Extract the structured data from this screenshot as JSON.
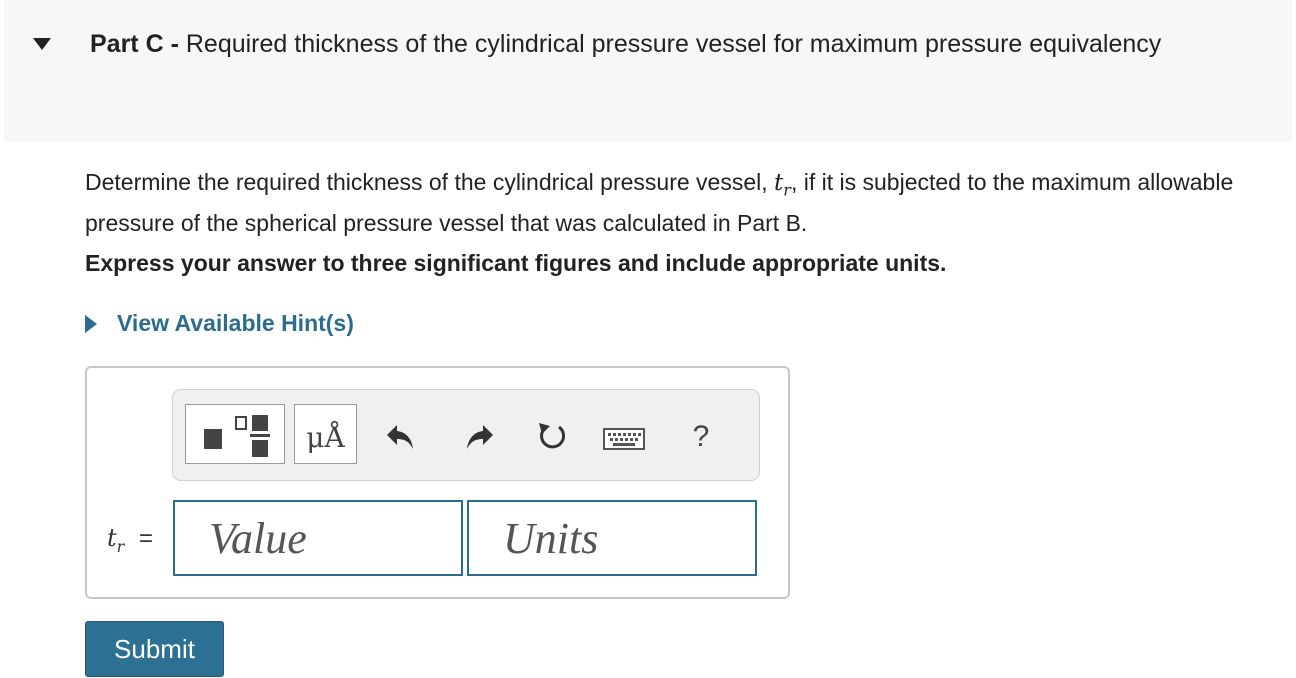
{
  "part": {
    "label": "Part C -",
    "title": "Required thickness of the cylindrical pressure vessel for maximum pressure equivalency"
  },
  "question": {
    "text_before": "Determine the required thickness of the cylindrical pressure vessel, ",
    "variable": "t",
    "variable_subscript": "r",
    "text_after": ", if it is subjected to the maximum allowable pressure of the spherical pressure vessel that was calculated in Part B."
  },
  "instruction": "Express your answer to three significant figures and include appropriate units.",
  "hint": {
    "label": "View Available Hint(s)"
  },
  "toolbar": {
    "templates_icon": "fraction-template-icon",
    "units_label": "μÅ",
    "undo_icon": "undo-icon",
    "redo_icon": "redo-icon",
    "reset_icon": "reset-icon",
    "keyboard_icon": "keyboard-icon",
    "help_label": "?"
  },
  "answer": {
    "variable": "t",
    "variable_subscript": "r",
    "equals": "=",
    "value_placeholder": "Value",
    "units_placeholder": "Units"
  },
  "submit_label": "Submit",
  "colors": {
    "accent": "#2c7193",
    "link": "#2c6d8f",
    "header_bg": "#f7f7f7"
  }
}
